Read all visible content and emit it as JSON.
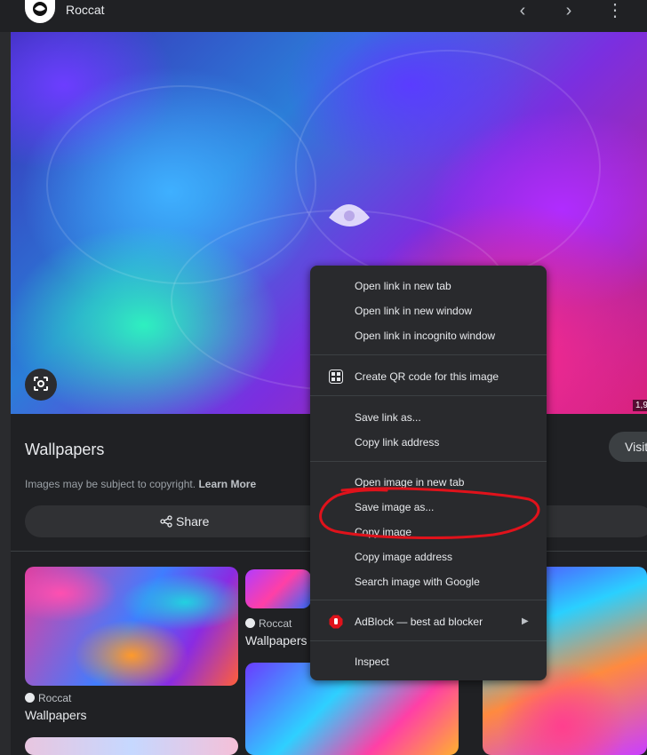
{
  "header": {
    "site_name": "Roccat",
    "nav_prev": "‹",
    "nav_next": "›",
    "more": "⋮"
  },
  "main_image": {
    "dimensions_label": "1,9"
  },
  "info": {
    "title": "Wallpapers",
    "visit_label": "Visit",
    "copyright_text": "Images may be subject to copyright.",
    "learn_more": "Learn More",
    "share_label": "Share"
  },
  "grid": {
    "items": [
      {
        "source": "Roccat",
        "title": "Wallpapers"
      },
      {
        "source": "Roccat",
        "title": "Wallpapers"
      }
    ]
  },
  "context_menu": {
    "items": [
      {
        "label": "Open link in new tab"
      },
      {
        "label": "Open link in new window"
      },
      {
        "label": "Open link in incognito window"
      },
      {
        "label": "Create QR code for this image"
      },
      {
        "label": "Save link as..."
      },
      {
        "label": "Copy link address"
      },
      {
        "label": "Open image in new tab"
      },
      {
        "label": "Save image as..."
      },
      {
        "label": "Copy image"
      },
      {
        "label": "Copy image address"
      },
      {
        "label": "Search image with Google"
      },
      {
        "label": "AdBlock — best ad blocker"
      },
      {
        "label": "Inspect"
      }
    ]
  },
  "colors": {
    "background": "#202124",
    "menu_background": "#292a2d",
    "annotation": "#e0121b",
    "adblock": "#e0121b"
  },
  "icons": {
    "lens": "google-lens-icon",
    "share": "share-icon",
    "qr": "qr-code-icon",
    "adblock": "adblock-hand-icon",
    "submenu": "triangle-right-icon"
  }
}
